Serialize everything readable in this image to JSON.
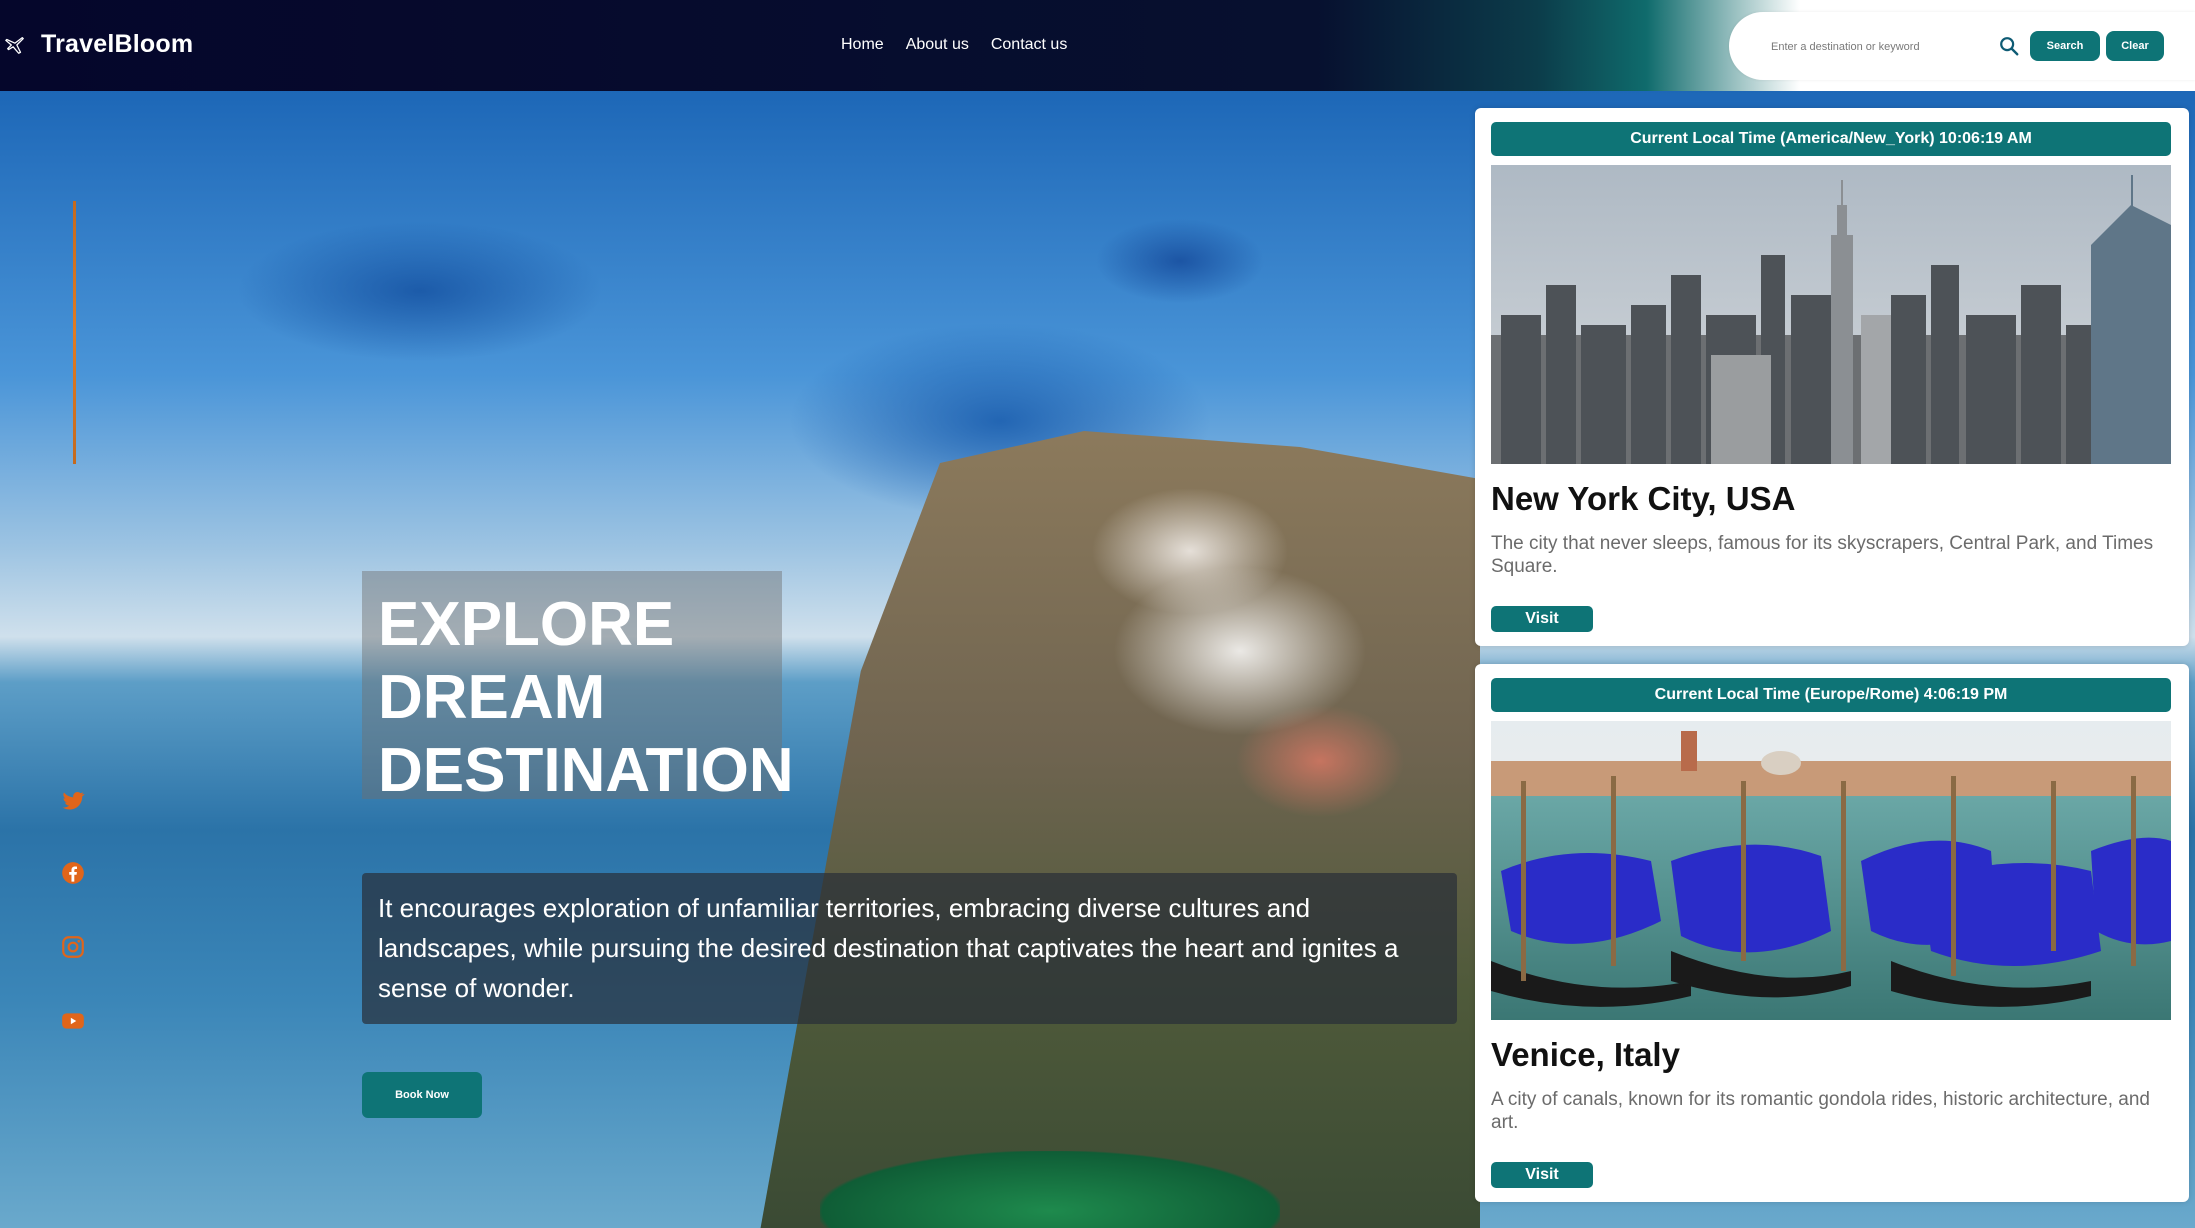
{
  "brand": {
    "name": "TravelBloom",
    "icon": "plane-icon"
  },
  "nav": {
    "links": [
      "Home",
      "About us",
      "Contact us"
    ]
  },
  "search": {
    "placeholder": "Enter a destination or keyword",
    "value": "",
    "search_label": "Search",
    "clear_label": "Clear",
    "icon": "search-icon"
  },
  "hero": {
    "headline_lines": [
      "EXPLORE",
      "DREAM",
      "DESTINATION"
    ],
    "description": "It encourages exploration of unfamiliar territories, embracing diverse cultures and landscapes, while pursuing the desired destination that captivates the heart and ignites a sense of wonder.",
    "book_label": "Book Now"
  },
  "social": [
    "twitter-icon",
    "facebook-icon",
    "instagram-icon",
    "youtube-icon"
  ],
  "colors": {
    "accent": "#0e7476",
    "social": "#e0651a",
    "nav_bg": "#05062b"
  },
  "results": [
    {
      "time_label": "Current Local Time (America/New_York) 10:06:19 AM",
      "name": "New York City, USA",
      "description": "The city that never sleeps, famous for its skyscrapers, Central Park, and Times Square.",
      "button": "Visit"
    },
    {
      "time_label": "Current Local Time (Europe/Rome) 4:06:19 PM",
      "name": "Venice, Italy",
      "description": "A city of canals, known for its romantic gondola rides, historic architecture, and art.",
      "button": "Visit"
    }
  ]
}
